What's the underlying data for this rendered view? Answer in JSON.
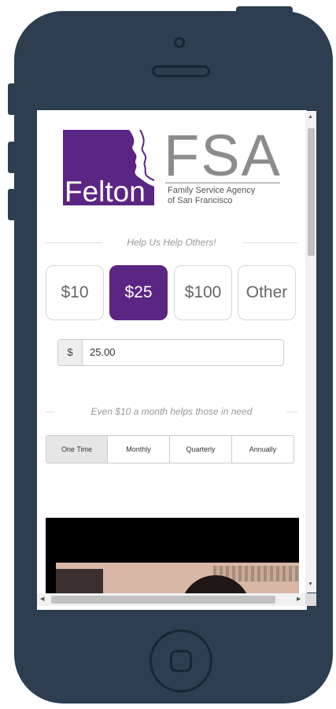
{
  "logo": {
    "brand_word": "Felton",
    "acronym": "FSA",
    "subtitle_line1": "Family Service Agency",
    "subtitle_line2": "of San Francisco",
    "purple": "#5b2583",
    "gray": "#8c8c8c"
  },
  "donation": {
    "heading": "Help Us Help Others!",
    "amounts": [
      {
        "label": "$10",
        "selected": false
      },
      {
        "label": "$25",
        "selected": true
      },
      {
        "label": "$100",
        "selected": false
      },
      {
        "label": "Other",
        "selected": false
      }
    ],
    "currency_symbol": "$",
    "amount_value": "25.00"
  },
  "frequency": {
    "heading": "Even $10 a month helps those in need",
    "options": [
      {
        "label": "One Time",
        "selected": true
      },
      {
        "label": "Monthly",
        "selected": false
      },
      {
        "label": "Quarterly",
        "selected": false
      },
      {
        "label": "Annually",
        "selected": false
      }
    ]
  },
  "icons": {
    "camera": "camera-icon",
    "speaker": "speaker-icon",
    "home": "home-button-icon"
  },
  "colors": {
    "phone_body": "#2c3e50",
    "accent": "#5b2583"
  }
}
